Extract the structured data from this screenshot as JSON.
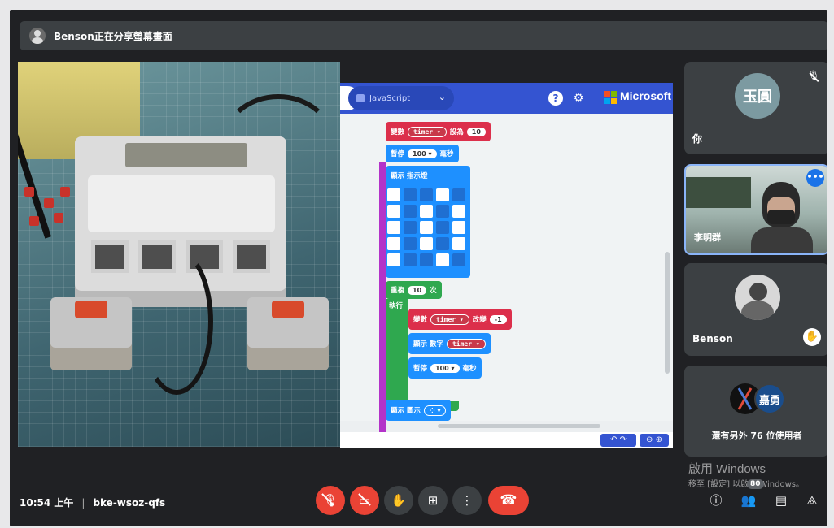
{
  "share_banner": {
    "text": "Benson正在分享螢幕畫面"
  },
  "editor": {
    "tab_label": "JavaScript",
    "brand": "Microsoft",
    "blocks": {
      "set_var": {
        "kw": "變數",
        "var": "timer",
        "op": "設為",
        "value": "10"
      },
      "pause1": {
        "kw": "暫停",
        "value": "100",
        "unit": "毫秒"
      },
      "show_leds": {
        "kw": "顯示 指示燈"
      },
      "repeat": {
        "kw": "重複",
        "value": "10",
        "unit": "次",
        "do": "執行"
      },
      "change_var": {
        "kw": "變數",
        "var": "timer",
        "op": "改變",
        "value": "-1"
      },
      "show_number": {
        "kw": "顯示 數字",
        "var": "timer"
      },
      "pause2": {
        "kw": "暫停",
        "value": "100",
        "unit": "毫秒"
      },
      "show_icon": {
        "kw": "顯示 圖示"
      }
    }
  },
  "participants": [
    {
      "avatar_text": "玉圓",
      "name": "你",
      "mic": "muted"
    },
    {
      "name": "李明群",
      "camera": "on"
    },
    {
      "name": "Benson",
      "raised_hand": true
    },
    {
      "avatar_text": "嘉勇",
      "others_text": "還有另外 76 位使用者"
    }
  ],
  "watermark": {
    "title": "啟用 Windows",
    "subtitle": "移至 [設定] 以啟用 Windows。"
  },
  "bottom_bar": {
    "time": "10:54 上午",
    "separator": "|",
    "meeting_code": "bke-wsoz-qfs",
    "people_count": "80"
  },
  "icons": {
    "mic_off": "mic-off-icon",
    "cam_off": "camera-off-icon",
    "hand": "raise-hand-icon",
    "present": "present-icon",
    "more": "more-options-icon",
    "hangup": "hang-up-icon",
    "info": "info-icon",
    "people": "people-icon",
    "chat": "chat-icon",
    "activities": "activities-icon"
  },
  "colors": {
    "red": "#ea4335",
    "bg": "#202124",
    "tile": "#3c4043",
    "makecode_blue": "#3454d1"
  }
}
